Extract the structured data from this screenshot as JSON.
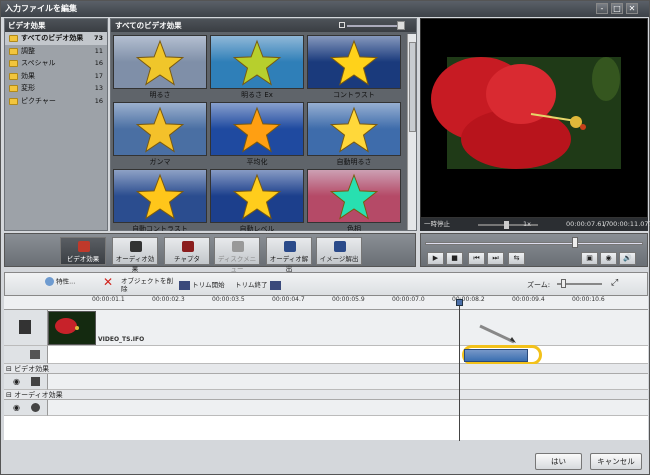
{
  "window": {
    "title": "入力ファイルを編集",
    "controls": [
      "-",
      "□",
      "✕"
    ]
  },
  "categories": {
    "header": "ビデオ効果",
    "items": [
      {
        "label": "すべてのビデオ効果",
        "count": "73",
        "selected": true
      },
      {
        "label": "調整",
        "count": "11"
      },
      {
        "label": "スペシャル",
        "count": "16"
      },
      {
        "label": "効果",
        "count": "17"
      },
      {
        "label": "変形",
        "count": "13"
      },
      {
        "label": "ピクチャー",
        "count": "16"
      }
    ]
  },
  "effects": {
    "header": "すべてのビデオ効果",
    "tiles": [
      {
        "label": "明るさ",
        "bg": "#7f8fa8",
        "star": "#f0c62a"
      },
      {
        "label": "明るさ Ex",
        "bg": "#2f7fb8",
        "star": "#b7cf2d"
      },
      {
        "label": "コントラスト",
        "bg": "#1a3a7c",
        "star": "#ffd21a"
      },
      {
        "label": "ガンマ",
        "bg": "#4a6fa3",
        "star": "#f4c12a"
      },
      {
        "label": "平均化",
        "bg": "#1f4aa0",
        "star": "#ff9f12"
      },
      {
        "label": "自動明るさ",
        "bg": "#3e6cab",
        "star": "#ffd83a"
      },
      {
        "label": "自動コントラスト",
        "bg": "#2b4d8f",
        "star": "#ffc61a"
      },
      {
        "label": "自動レベル",
        "bg": "#1c3f8c",
        "star": "#ffcd1c"
      },
      {
        "label": "色相",
        "bg": "#b54a67",
        "star": "#28e0b0"
      }
    ]
  },
  "preview": {
    "status": "一時停止",
    "speed": "1x",
    "current_time": "00:00:07.617",
    "total_time": "00:00:11.077",
    "time_separator": "/"
  },
  "toolbar": {
    "buttons": [
      {
        "label": "ビデオ効果",
        "state": "active"
      },
      {
        "label": "オーディオ効果",
        "state": "normal"
      },
      {
        "label": "チャプタ",
        "state": "normal"
      },
      {
        "label": "ディスクメニュー",
        "state": "disabled"
      },
      {
        "label": "オーディオ解出",
        "state": "normal"
      },
      {
        "label": "イメージ解出",
        "state": "normal"
      }
    ]
  },
  "playback": {
    "buttons": [
      "▶",
      "■",
      "⏮",
      "⏭",
      "⇆"
    ],
    "right_buttons": [
      "▣",
      "◉",
      "🔊"
    ],
    "position": 0.687
  },
  "timeline": {
    "buttons": {
      "properties": "特性...",
      "delete_object": "オブジェクトを削除",
      "trim_start": "トリム開始",
      "trim_end": "トリム終了"
    },
    "zoom_label": "ズーム:",
    "ruler": [
      "00:00:01.1",
      "00:00:02.3",
      "00:00:03.5",
      "00:00:04.7",
      "00:00:05.9",
      "00:00:07.0",
      "00:00:08.2",
      "00:00:09.4",
      "00:00:10.6"
    ],
    "clip_name": "VIDEO_TS.IFO",
    "video_effects_label": "ビデオ効果",
    "audio_effects_label": "オーディオ効果"
  },
  "dialog": {
    "ok": "はい",
    "cancel": "キャンセル"
  },
  "colors": {
    "accent": "#3b6fb0",
    "highlight": "#f2c11a"
  }
}
